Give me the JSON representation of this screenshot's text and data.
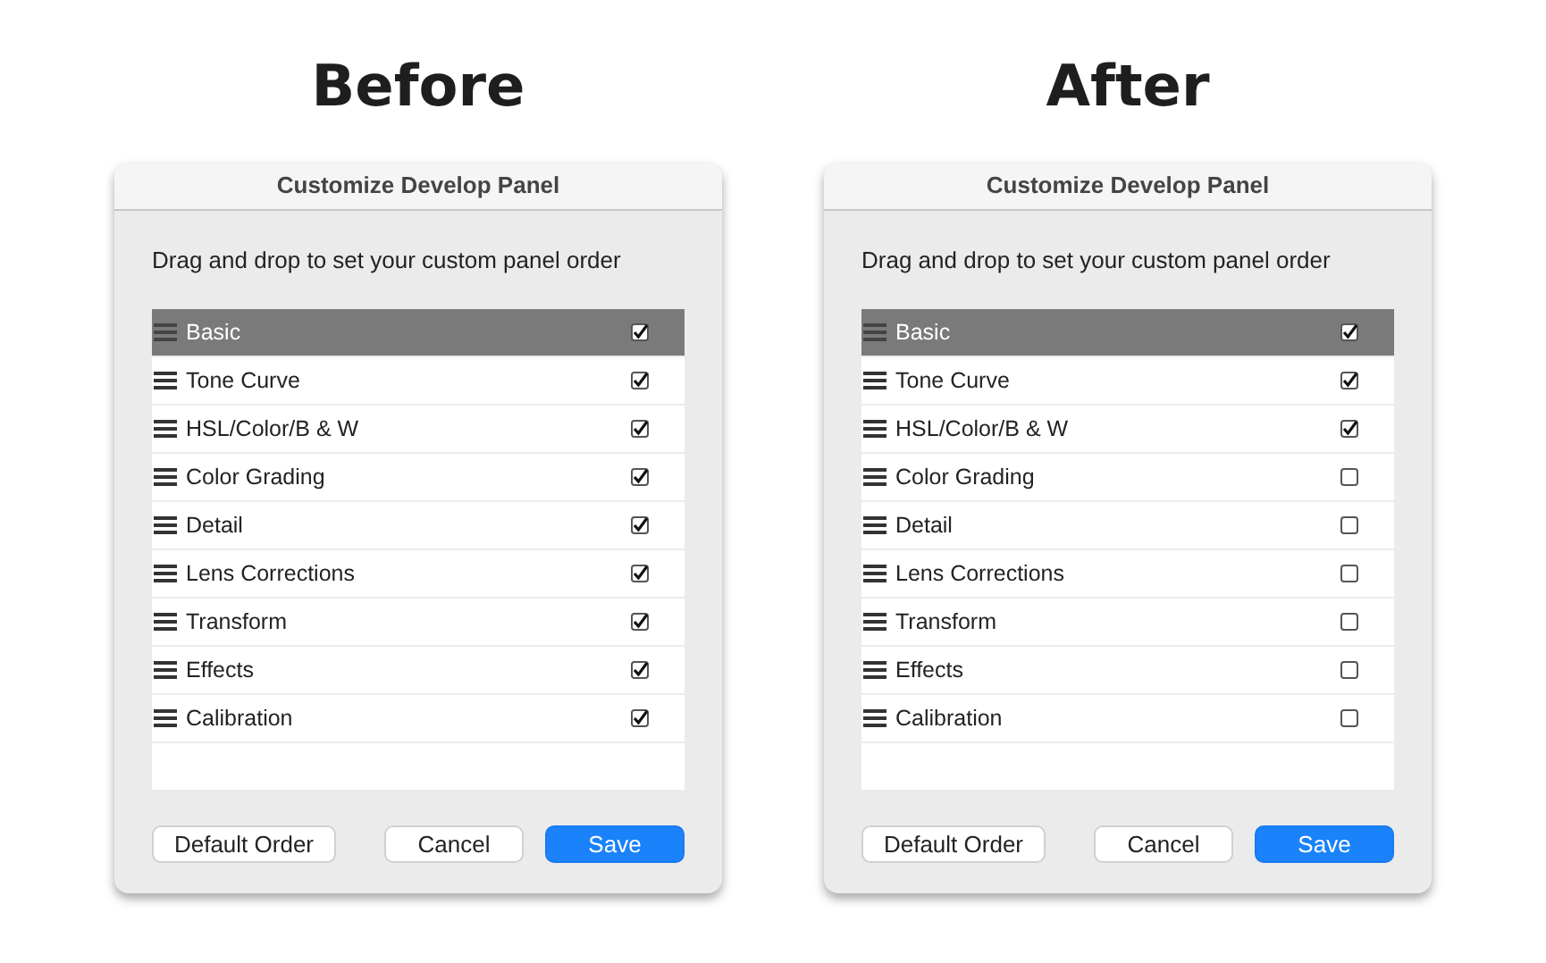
{
  "panels": [
    {
      "heading": "Before",
      "title": "Customize Develop Panel",
      "instruction": "Drag and drop to set your custom panel order",
      "rows": [
        {
          "label": "Basic",
          "checked": true,
          "selected": true
        },
        {
          "label": "Tone Curve",
          "checked": true,
          "selected": false
        },
        {
          "label": "HSL/Color/B & W",
          "checked": true,
          "selected": false
        },
        {
          "label": "Color Grading",
          "checked": true,
          "selected": false
        },
        {
          "label": "Detail",
          "checked": true,
          "selected": false
        },
        {
          "label": "Lens Corrections",
          "checked": true,
          "selected": false
        },
        {
          "label": "Transform",
          "checked": true,
          "selected": false
        },
        {
          "label": "Effects",
          "checked": true,
          "selected": false
        },
        {
          "label": "Calibration",
          "checked": true,
          "selected": false
        }
      ],
      "buttons": [
        {
          "label": "Default Order",
          "kind": "plain"
        },
        {
          "label": "Cancel",
          "kind": "plain"
        },
        {
          "label": "Save",
          "kind": "primary"
        }
      ]
    },
    {
      "heading": "After",
      "title": "Customize Develop Panel",
      "instruction": "Drag and drop to set your custom panel order",
      "rows": [
        {
          "label": "Basic",
          "checked": true,
          "selected": true
        },
        {
          "label": "Tone Curve",
          "checked": true,
          "selected": false
        },
        {
          "label": "HSL/Color/B & W",
          "checked": true,
          "selected": false
        },
        {
          "label": "Color Grading",
          "checked": false,
          "selected": false
        },
        {
          "label": "Detail",
          "checked": false,
          "selected": false
        },
        {
          "label": "Lens Corrections",
          "checked": false,
          "selected": false
        },
        {
          "label": "Transform",
          "checked": false,
          "selected": false
        },
        {
          "label": "Effects",
          "checked": false,
          "selected": false
        },
        {
          "label": "Calibration",
          "checked": false,
          "selected": false
        }
      ],
      "buttons": [
        {
          "label": "Default Order",
          "kind": "plain"
        },
        {
          "label": "Cancel",
          "kind": "plain"
        },
        {
          "label": "Save",
          "kind": "primary"
        }
      ]
    }
  ]
}
